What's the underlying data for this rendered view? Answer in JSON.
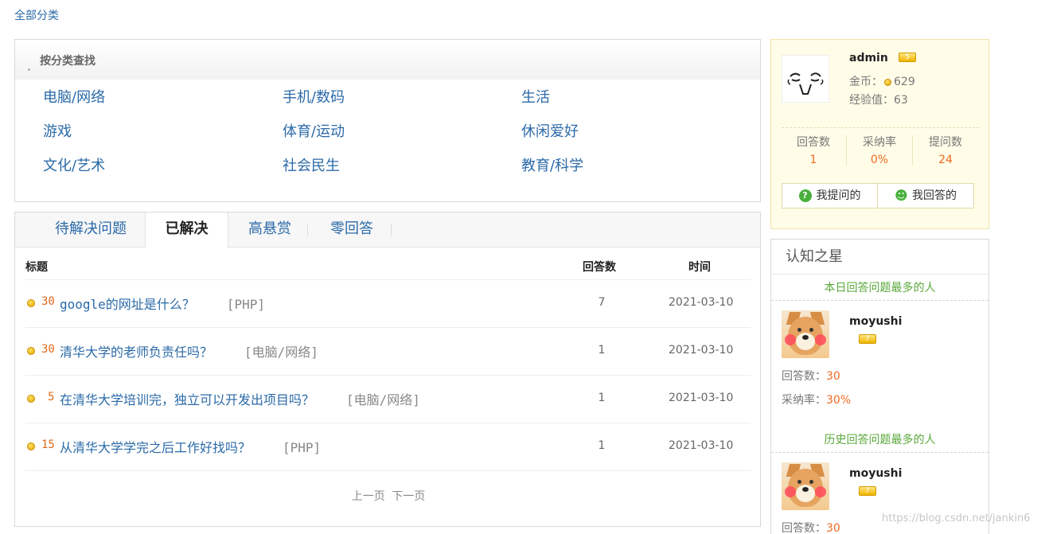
{
  "breadcrumb": "全部分类",
  "category_box": {
    "title": "按分类查找",
    "items": [
      "电脑/网络",
      "手机/数码",
      "生活",
      "游戏",
      "体育/运动",
      "休闲爱好",
      "文化/艺术",
      "社会民生",
      "教育/科学"
    ]
  },
  "tabs": [
    "待解决问题",
    "已解决",
    "高悬赏",
    "零回答"
  ],
  "active_tab": "已解决",
  "table": {
    "columns": [
      "标题",
      "回答数",
      "时间"
    ],
    "rows": [
      {
        "reward": "30",
        "title": "google的网址是什么？",
        "tag": "[PHP]",
        "answers": "7",
        "date": "2021-03-10"
      },
      {
        "reward": "30",
        "title": "清华大学的老师负责任吗？",
        "tag": "[电脑/网络]",
        "answers": "1",
        "date": "2021-03-10"
      },
      {
        "reward": "5",
        "title": "在清华大学培训完，独立可以开发出项目吗？",
        "tag": "[电脑/网络]",
        "answers": "1",
        "date": "2021-03-10"
      },
      {
        "reward": "15",
        "title": "从清华大学学完之后工作好找吗？",
        "tag": "[PHP]",
        "answers": "1",
        "date": "2021-03-10"
      }
    ]
  },
  "pager": {
    "prev": "上一页",
    "next": "下一页"
  },
  "user": {
    "name": "admin",
    "level": "5",
    "coins_label": "金币：",
    "coins": "629",
    "exp_label": "经验值：",
    "exp": "63",
    "stats": [
      {
        "label": "回答数",
        "value": "1"
      },
      {
        "label": "采纳率",
        "value": "0%"
      },
      {
        "label": "提问数",
        "value": "24"
      }
    ],
    "btn_ask": "我提问的",
    "btn_answer": "我回答的"
  },
  "stars": {
    "title": "认知之星",
    "today_title": "本日回答问题最多的人",
    "today": {
      "name": "moyushi",
      "level": "7",
      "answers_label": "回答数：",
      "answers": "30",
      "rate_label": "采纳率：",
      "rate": "30%"
    },
    "history_title": "历史回答问题最多的人",
    "history": {
      "name": "moyushi",
      "level": "7",
      "answers_label": "回答数：",
      "answers": "30"
    }
  },
  "watermark": "https://blog.csdn.net/jankin6",
  "colors": {
    "link": "#2b6aa8",
    "accent": "#f06a20",
    "green": "#58a83a"
  }
}
